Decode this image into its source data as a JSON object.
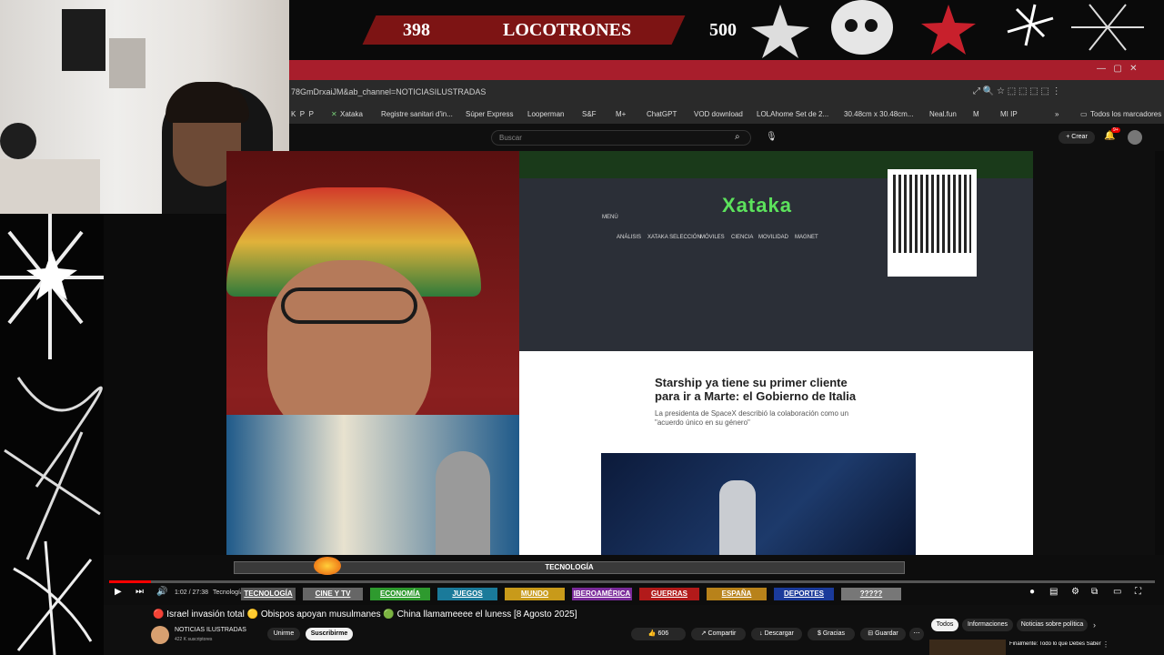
{
  "banner": {
    "left_count": "398",
    "title": "LOCOTRONES",
    "right_count": "500"
  },
  "browser": {
    "url_fragment": "78GmDrxaiJM&ab_channel=NOTICIASILUSTRADAS",
    "bookmarks": [
      "Xataka",
      "Registre sanitari d'in...",
      "Súper Express",
      "Looperman",
      "S&F",
      "M+",
      "ChatGPT",
      "VOD download",
      "LOLAhome Set de 2...",
      "30.48cm x 30.48cm...",
      "Neal.fun",
      "M",
      "MI IP"
    ],
    "all_bookmarks": "Todos los marcadores"
  },
  "youtube": {
    "search_placeholder": "Buscar",
    "create_label": "Crear",
    "notif_count": "9+",
    "time": "1:02 / 27:38",
    "chapter": "Tecnología",
    "video_title": "🔴 Israel invasión total 🟡 Obispos apoyan musulmanes 🟢 China llamameeee el luness [8 Agosto 2025]",
    "channel": "NOTICIAS ILUSTRADAS",
    "subscribers": "422 K suscriptores",
    "join": "Unirme",
    "subscribe": "Suscribirme",
    "likes": "606",
    "share": "Compartir",
    "download": "Descargar",
    "thanks": "Gracias",
    "save": "Guardar",
    "chips": [
      "Todos",
      "Informaciones",
      "Noticias sobre política"
    ],
    "related_title": "Finalmente: Todo lo que Debes Saber sobre el Viento..."
  },
  "ticker": {
    "label": "TECNOLOGÍA",
    "categories": [
      "TECNOLOGÍA",
      "CINE Y TV",
      "ECONOMÍA",
      "JUEGOS",
      "MUNDO",
      "IBEROAMÉRICA",
      "GUERRAS",
      "ESPAÑA",
      "DEPORTES",
      "?????"
    ]
  },
  "site": {
    "logo": "Xataka",
    "menu": "MENÚ",
    "nav": [
      "ANÁLISIS",
      "XATAKA SELECCIÓN",
      "MÓVILES",
      "CIENCIA",
      "MOVILIDAD",
      "MAGNET"
    ],
    "headline": "Starship ya tiene su primer cliente para ir a Marte: el Gobierno de Italia",
    "subhead": "La presidenta de SpaceX describió la colaboración como un \"acuerdo único en su género\""
  },
  "colors": {
    "banner_red": "#7d1414",
    "strip_red": "#a81e2c",
    "xataka_green": "#5ce25c",
    "progress": "#ff0000"
  }
}
